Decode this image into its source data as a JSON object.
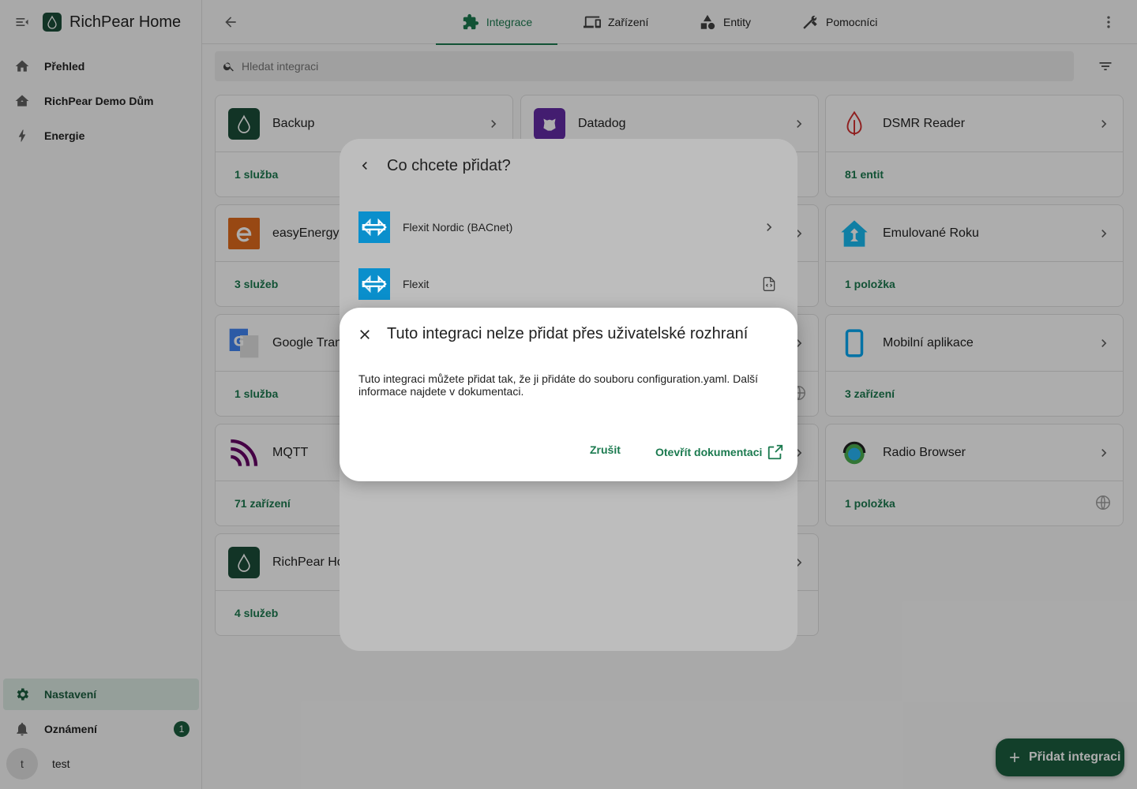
{
  "app": {
    "title": "RichPear Home"
  },
  "sidebar": {
    "items": [
      {
        "label": "Přehled",
        "icon": "home-icon"
      },
      {
        "label": "RichPear Demo Dům",
        "icon": "home-outline-icon"
      },
      {
        "label": "Energie",
        "icon": "lightning-icon"
      }
    ],
    "bottom": {
      "settings": "Nastavení",
      "notifications": "Oznámení",
      "notifications_count": "1",
      "user_initial": "t",
      "user_name": "test"
    }
  },
  "tabs": [
    {
      "label": "Integrace",
      "icon": "puzzle-icon",
      "active": true
    },
    {
      "label": "Zařízení",
      "icon": "devices-icon"
    },
    {
      "label": "Entity",
      "icon": "shapes-icon"
    },
    {
      "label": "Pomocníci",
      "icon": "tools-icon"
    }
  ],
  "search": {
    "placeholder": "Hledat integraci"
  },
  "cards": [
    {
      "name": "Backup",
      "count": "1 služba"
    },
    {
      "name": "Datadog",
      "count": ""
    },
    {
      "name": "DSMR Reader",
      "count": "81 entit"
    },
    {
      "name": "easyEnergy",
      "count": "3 služeb"
    },
    {
      "name": "Emulované Roku",
      "count": "1 položka"
    },
    {
      "name": "Google Tran",
      "count": "1 služba"
    },
    {
      "name": "Mobilní aplikace",
      "count": "3 zařízení"
    },
    {
      "name": "MQTT",
      "count": "71 zařízení"
    },
    {
      "name": "Radio Browser",
      "count": "1 položka"
    },
    {
      "name": "RichPear Ho",
      "count": "4 služeb"
    }
  ],
  "add_dialog": {
    "title": "Co chcete přidat?",
    "items": [
      {
        "name": "Flexit Nordic (BACnet)"
      },
      {
        "name": "Flexit"
      }
    ]
  },
  "error_dialog": {
    "title": "Tuto integraci nelze přidat přes uživatelské rozhraní",
    "body": "Tuto integraci můžete přidat tak, že ji přidáte do souboru configuration.yaml. Další informace najdete v dokumentaci.",
    "cancel": "Zrušit",
    "open_docs": "Otevřít dokumentaci"
  },
  "fab": {
    "label": "Přidat integraci"
  },
  "colors": {
    "accent": "#1b7a4f",
    "primary_dark": "#1b5e3f"
  }
}
